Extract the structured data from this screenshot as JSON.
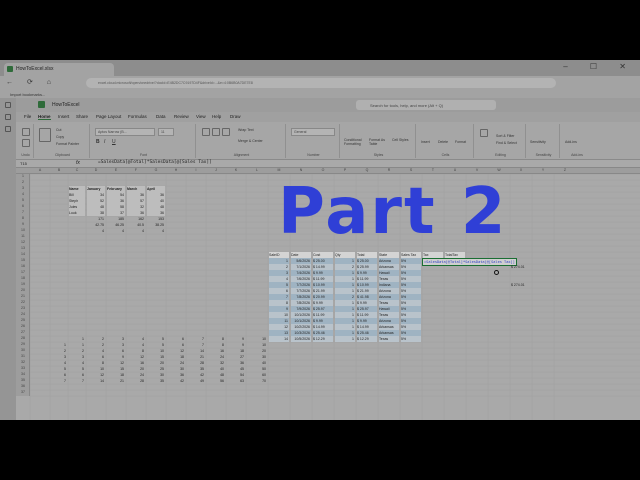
{
  "browser": {
    "tab_title": "HowToExcel.xlsx",
    "window_controls": "– ☐ ✕",
    "nav_glyphs": "← ⟳ ⌂",
    "url": "excel.cloud.microsoft/open/onedrive/?docId=E4B2DC7C9197D4F&driveId=...&e=4:0B6B0A7DE7E8",
    "bookmarks_label": "Import bookmarks..."
  },
  "office": {
    "file_name": "HowToExcel",
    "search_placeholder": "Search for tools, help, and more (Alt + Q)"
  },
  "menu": [
    "File",
    "Home",
    "Insert",
    "Share",
    "Page Layout",
    "Formulas",
    "Data",
    "Review",
    "View",
    "Help",
    "Draw"
  ],
  "ribbon": {
    "groups": [
      "Undo",
      "Clipboard",
      "Font",
      "Alignment",
      "Number",
      "Styles",
      "Cells",
      "Editing",
      "Sensitivity",
      "Add-ins"
    ],
    "font_name": "Aptos Narrow (B...",
    "font_size": "11",
    "wrap_text": "Wrap Text",
    "merge_center": "Merge & Center",
    "number_format": "General",
    "cond_format": "Conditional Formatting",
    "format_table": "Format As Table",
    "cell_styles": "Cell Styles",
    "insert": "Insert",
    "delete": "Delete",
    "format": "Format",
    "sort_filter": "Sort & Filter",
    "find_select": "Find & Select",
    "sensitivity": "Sensitivity",
    "addins": "Add-ins",
    "cut": "Cut",
    "copy": "Copy",
    "format_painter": "Format Painter"
  },
  "formula_bar": {
    "name_box": "T15",
    "fx": "fx",
    "formula": "=SalesData[@Total]*SalesData[@[Sales Tax]]"
  },
  "columns": [
    "A",
    "B",
    "C",
    "D",
    "E",
    "F",
    "G",
    "H",
    "I",
    "J",
    "K",
    "L",
    "M",
    "N",
    "O",
    "P",
    "Q",
    "R",
    "S",
    "T",
    "U",
    "V",
    "W",
    "X",
    "Y",
    "Z"
  ],
  "rows": [
    "1",
    "2",
    "3",
    "4",
    "5",
    "6",
    "7",
    "8",
    "9",
    "10",
    "11",
    "12",
    "13",
    "14",
    "15",
    "16",
    "17",
    "18",
    "19",
    "20",
    "21",
    "22",
    "23",
    "24",
    "25",
    "26",
    "27",
    "28",
    "29",
    "30",
    "31",
    "32",
    "33",
    "34",
    "35",
    "36",
    "37"
  ],
  "table1": {
    "headers": [
      "Name",
      "January",
      "February",
      "March",
      "April"
    ],
    "rows": [
      [
        "Bill",
        "34",
        "54",
        "36",
        "36"
      ],
      [
        "Steph",
        "52",
        "36",
        "57",
        "40"
      ],
      [
        "Jules",
        "48",
        "58",
        "32",
        "48"
      ],
      [
        "Luuk",
        "38",
        "37",
        "36",
        "36"
      ]
    ],
    "totals": [
      "",
      "171",
      "185",
      "162",
      "153"
    ],
    "averages": [
      "",
      "42.75",
      "46.25",
      "40.5",
      "38.25"
    ],
    "counts": [
      "",
      "4",
      "4",
      "4",
      "4"
    ]
  },
  "sales_table": {
    "headers": [
      "SaleID",
      "Date",
      "Cost",
      "Qty",
      "Total",
      "State",
      "Sales Tax",
      "Tax",
      "TotalTax"
    ],
    "rows": [
      [
        "1",
        "5/6/2026",
        "$",
        "25.00",
        "1",
        "$",
        "25.00",
        "Arizona",
        "5%"
      ],
      [
        "2",
        "7/1/2026",
        "$",
        "14.99",
        "2",
        "$",
        "25.99",
        "Arkansas",
        "5%"
      ],
      [
        "3",
        "7/4/2026",
        "$",
        "9.99",
        "1",
        "$",
        "9.99",
        "Hawaii",
        "5%"
      ],
      [
        "4",
        "7/6/2026",
        "$",
        "11.99",
        "1",
        "$",
        "11.99",
        "Texas",
        "5%"
      ],
      [
        "5",
        "7/7/2026",
        "$",
        "10.99",
        "1",
        "$",
        "10.99",
        "Indiana",
        "5%"
      ],
      [
        "6",
        "7/7/2026",
        "$",
        "21.99",
        "1",
        "$",
        "21.99",
        "Arizona",
        "5%"
      ],
      [
        "7",
        "7/8/2026",
        "$",
        "20.99",
        "2",
        "$",
        "41.98",
        "Arizona",
        "5%"
      ],
      [
        "8",
        "7/8/2026",
        "$",
        "9.99",
        "1",
        "$",
        "9.99",
        "Texas",
        "5%"
      ],
      [
        "9",
        "7/9/2026",
        "$",
        "25.97",
        "1",
        "$",
        "25.97",
        "Hawaii",
        "5%"
      ],
      [
        "10",
        "10/1/2026",
        "$",
        "11.99",
        "1",
        "$",
        "11.99",
        "Texas",
        "5%"
      ],
      [
        "11",
        "10/1/2026",
        "$",
        "9.99",
        "1",
        "$",
        "9.99",
        "Arizona",
        "5%"
      ],
      [
        "12",
        "10/2/2026",
        "$",
        "14.99",
        "1",
        "$",
        "14.99",
        "Arkansas",
        "5%"
      ],
      [
        "13",
        "10/3/2026",
        "$",
        "25.46",
        "1",
        "$",
        "25.46",
        "Arkansas",
        "5%"
      ],
      [
        "14",
        "10/5/2026",
        "$",
        "12.29",
        "1",
        "$",
        "12.29",
        "Texas",
        "5%"
      ]
    ],
    "edit_text": "=SalesData[@Total]*SalesData[@[Sales Tax]]",
    "side_values": [
      {
        "symbol": "$",
        "value": "274.01"
      },
      {
        "symbol": "$",
        "value": "274.01"
      }
    ]
  },
  "mult_table": {
    "header": [
      "1",
      "2",
      "3",
      "4",
      "5",
      "6",
      "7",
      "8",
      "9",
      "10"
    ],
    "rows": [
      [
        "1",
        "1",
        "2",
        "3",
        "4",
        "5",
        "6",
        "7",
        "8",
        "9",
        "10"
      ],
      [
        "2",
        "2",
        "4",
        "6",
        "8",
        "10",
        "12",
        "14",
        "16",
        "18",
        "20"
      ],
      [
        "3",
        "3",
        "6",
        "9",
        "12",
        "15",
        "18",
        "21",
        "24",
        "27",
        "30"
      ],
      [
        "4",
        "4",
        "8",
        "12",
        "16",
        "20",
        "24",
        "28",
        "32",
        "36",
        "40"
      ],
      [
        "5",
        "5",
        "10",
        "15",
        "20",
        "25",
        "30",
        "35",
        "40",
        "45",
        "50"
      ],
      [
        "6",
        "6",
        "12",
        "18",
        "24",
        "30",
        "36",
        "42",
        "48",
        "54",
        "60"
      ],
      [
        "7",
        "7",
        "14",
        "21",
        "28",
        "35",
        "42",
        "49",
        "56",
        "63",
        "70"
      ]
    ]
  },
  "overlay_title": "Part 2"
}
